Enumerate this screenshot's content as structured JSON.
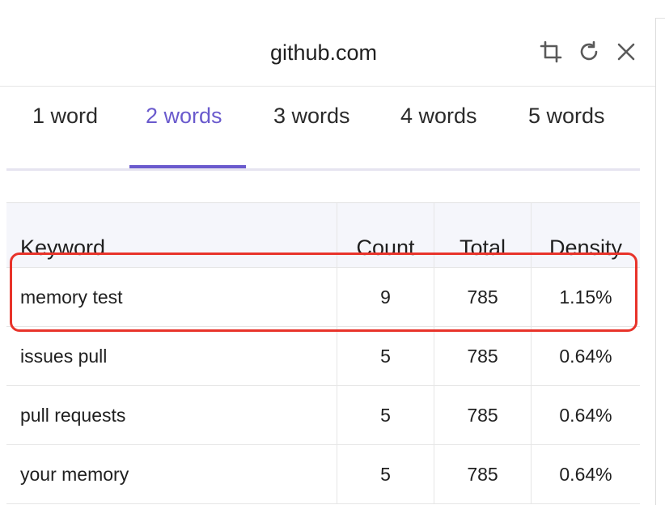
{
  "header": {
    "title": "github.com",
    "icons": [
      "crop-icon",
      "refresh-icon",
      "close-icon"
    ]
  },
  "tabs": [
    {
      "label": "1 word",
      "active": false
    },
    {
      "label": "2 words",
      "active": true
    },
    {
      "label": "3 words",
      "active": false
    },
    {
      "label": "4 words",
      "active": false
    },
    {
      "label": "5 words",
      "active": false
    }
  ],
  "table": {
    "columns": [
      "Keyword",
      "Count",
      "Total",
      "Density"
    ],
    "rows": [
      {
        "keyword": "memory test",
        "count": "9",
        "total": "785",
        "density": "1.15%"
      },
      {
        "keyword": "issues pull",
        "count": "5",
        "total": "785",
        "density": "0.64%"
      },
      {
        "keyword": "pull requests",
        "count": "5",
        "total": "785",
        "density": "0.64%"
      },
      {
        "keyword": "your memory",
        "count": "5",
        "total": "785",
        "density": "0.64%"
      }
    ],
    "highlighted_row": 0
  },
  "colors": {
    "accent": "#6a5acd",
    "highlight": "#e8332a",
    "header_bg": "#f5f6fb"
  }
}
